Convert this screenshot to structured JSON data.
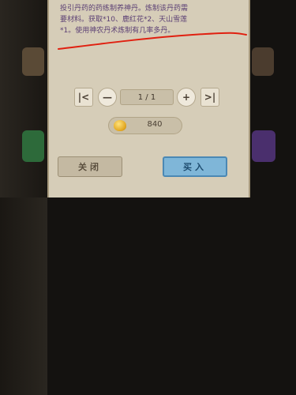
{
  "description": {
    "text": "投引丹药的药练制养神丹。炼制该丹药需\n要材料。获取*10、鹿红花*2、天山雪莲\n*1。使用神农丹术炼制有几率多丹。"
  },
  "quantity": {
    "first_label": "|<",
    "minus_label": "—",
    "value": "1 / 1",
    "plus_label": "+",
    "last_label": ">|"
  },
  "price": {
    "value": "840",
    "icon": "gold-ingot-icon"
  },
  "buttons": {
    "close_label": "关闭",
    "buy_label": "买入"
  },
  "colors": {
    "dialog_bg": "#d6cdb8",
    "text": "#5b3f74",
    "buy_button": "#7fb6d8",
    "underline": "#e02010"
  }
}
